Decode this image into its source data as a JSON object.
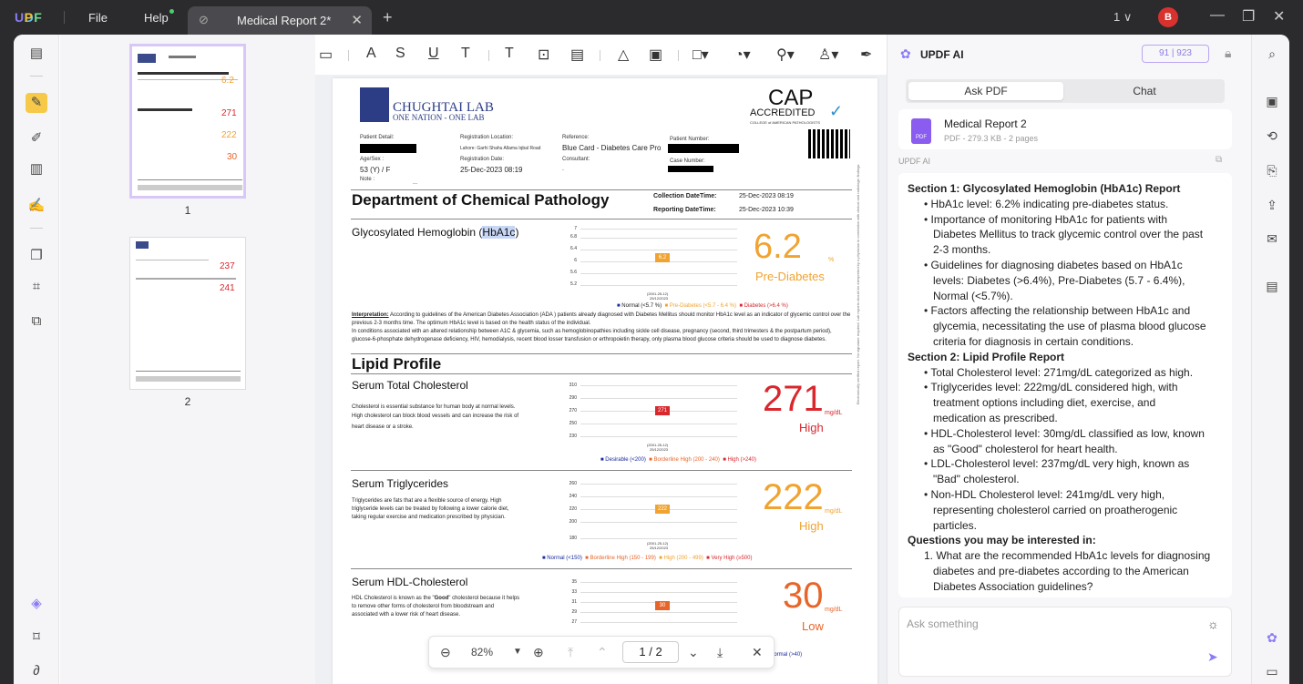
{
  "app": {
    "logo": "UPDF",
    "menu_file": "File",
    "menu_help": "Help",
    "tab_title": "Medical Report 2*",
    "tab_close": "✕",
    "new_tab": "+",
    "page_indicator": "1 ∨",
    "avatar_letter": "B",
    "minimize": "—",
    "restore": "❐",
    "close": "✕",
    "accent_color": "#8a7cf5"
  },
  "thumbnails": [
    {
      "number": "1",
      "v1": "6.2",
      "v2": "271",
      "v3": "222",
      "v4": "30"
    },
    {
      "number": "2",
      "v1": "237",
      "v2": "241"
    }
  ],
  "document": {
    "lab_name": "CHUGHTAI LAB",
    "lab_motto": "ONE NATION - ONE LAB",
    "cap": "CAP",
    "cap_accredited": "ACCREDITED",
    "cap_college": "COLLEGE of AMERICAN PATHOLOGISTS",
    "patient_detail_label": "Patient Detail:",
    "registration_location_label": "Registration Location:",
    "registration_location": "Lahore: Garhi Shahu Allama Iqbal Road",
    "reference_label": "Reference:",
    "reference": "Blue Card - Diabetes Care Pro",
    "patient_number_label": "Patient Number:",
    "age_sex_label": "Age/Sex :",
    "age_sex": "53 (Y) / F",
    "registration_date_label": "Registration Date:",
    "registration_date": "25-Dec-2023 08:19",
    "consultant_label": "Consultant:",
    "consultant": ".",
    "case_number_label": "Case Number:",
    "note_label": "Note :",
    "note_value": "...",
    "department": "Department of Chemical Pathology",
    "collection_label": "Collection DateTime:",
    "collection_value": "25-Dec-2023 08:19",
    "reporting_label": "Reporting DateTime:",
    "reporting_value": "25-Dec-2023 10:39",
    "hba1c": {
      "title_prefix": "Glycosylated Hemoglobin (",
      "title_highlight": "HbA1c",
      "title_suffix": ")",
      "value": "6.2",
      "unit": "%",
      "status": "Pre-Diabetes",
      "status_color": "#f0a330",
      "yticks": [
        "7",
        "6.8",
        "6.4",
        "6",
        "5.6",
        "5.2"
      ],
      "bar_label": "6.2",
      "date_label": "(2001-25-12)",
      "date_label2": "25/12/2023",
      "legend": [
        "Normal (<5.7 %)",
        "Pre-Diabetes (<5.7 - 6.4 %)",
        "Diabetes (>6.4 %)"
      ],
      "interpretation_label": "Interpretation:",
      "interpretation_1": "According to guidelines of the American Diabetes Association (ADA ) patients already diagnosed with Diabetes Mellitus should monitor HbA1c level as an",
      "interpretation_2": "indicator of glycemic control over the previous 2-3 months time. The optimum HbA1c level is based on the health status of the individual.",
      "interpretation_3": "In conditions associated with an altered relationship between A1C & glycemia, such as hemoglobinopathies including sickle cell disease, pregnancy (second, third trimesters",
      "interpretation_4": "& the postpartum period), glucose-6-phosphate dehydrogenase deficiency, HIV, hemodialysis, recent blood losser transfusion or erthropoietin therapy, only plasma blood",
      "interpretation_5": "glucose criteria should be used to diagnose diabetes."
    },
    "lipid_title": "Lipid Profile",
    "cholesterol": {
      "title": "Serum Total Cholesterol",
      "desc_1": "Cholesterol is essential substance for human body at normal levels.",
      "desc_2": "High cholesterol can block blood vessels and can increase the risk of",
      "desc_3": "heart disease or a stroke.",
      "value": "271",
      "unit": "mg/dL",
      "status": "High",
      "color": "#d8272d",
      "yticks": [
        "310",
        "290",
        "270",
        "250",
        "230"
      ],
      "bar_label": "271",
      "date_label": "(2001-25-12)",
      "date_label2": "25/12/2023",
      "legend": [
        "Desirable (<200)",
        "Borderline High (200 - 240)",
        "High (>240)"
      ]
    },
    "triglycerides": {
      "title": "Serum Triglycerides",
      "desc_1": "Triglycerides are fats that are a flexible source of energy. High",
      "desc_2": "triglyceride levels can be treated by following a lower calorie diet,",
      "desc_3": "taking regular exercise and medication prescribed by physician.",
      "value": "222",
      "unit": "mg/dL",
      "status": "High",
      "color": "#f0a330",
      "yticks": [
        "260",
        "240",
        "220",
        "200",
        "180"
      ],
      "bar_label": "222",
      "date_label": "(2001-25-12)",
      "date_label2": "25/12/2023",
      "legend": [
        "Normal (<150)",
        "Borderline High (150 - 199)",
        "High (200 - 499)",
        "Very High (≥500)"
      ]
    },
    "hdl": {
      "title": "Serum HDL-Cholesterol",
      "desc_1_a": "HDL Cholesterol is known as the \"",
      "desc_1_b": "Good",
      "desc_1_c": "\" cholesterol because it helps",
      "desc_2": "to remove other forms of cholesterol from bloodstream and",
      "desc_3": "associated with a lower risk of heart disease.",
      "value": "30",
      "unit": "mg/dL",
      "status": "Low",
      "color": "#e8652a",
      "yticks": [
        "35",
        "33",
        "31",
        "29",
        "27"
      ],
      "bar_label": "30",
      "legend_partial": "Normal (>40)"
    },
    "side_note": "Electronically verified report. No signature required. Lab reports should be interpreted by a physician in correlation with clinical and radiologic findings."
  },
  "nav": {
    "zoom": "82%",
    "page_current": "1",
    "page_sep": "/",
    "page_total": "2"
  },
  "ai": {
    "title": "UPDF AI",
    "credits_a": "91",
    "credits_b": "923",
    "tab_ask": "Ask PDF",
    "tab_chat": "Chat",
    "file_name": "Medical Report 2",
    "file_meta": "PDF - 279.3 KB - 2 pages",
    "file_icon_label": "PDF",
    "section_label": "UPDF AI",
    "messages": [
      {
        "text": "Section 1: Glycosylated Hemoglobin (HbA1c) Report",
        "bold": true,
        "indent": 0
      },
      {
        "text": "• HbA1c level: 6.2% indicating pre-diabetes status.",
        "indent": 1
      },
      {
        "text": "• Importance of monitoring HbA1c for patients with",
        "indent": 1
      },
      {
        "text": "Diabetes Mellitus to track glycemic control over the past",
        "indent": 2
      },
      {
        "text": "2-3 months.",
        "indent": 2
      },
      {
        "text": "• Guidelines for diagnosing diabetes based on HbA1c",
        "indent": 1
      },
      {
        "text": "levels: Diabetes (>6.4%), Pre-Diabetes (5.7 - 6.4%),",
        "indent": 2
      },
      {
        "text": "Normal (<5.7%).",
        "indent": 2
      },
      {
        "text": "• Factors affecting the relationship between HbA1c and",
        "indent": 1
      },
      {
        "text": "glycemia, necessitating the use of plasma blood glucose",
        "indent": 2
      },
      {
        "text": "criteria for diagnosis in certain conditions.",
        "indent": 2
      },
      {
        "text": "Section 2: Lipid Profile Report",
        "bold": true,
        "indent": 0
      },
      {
        "text": "• Total Cholesterol level: 271mg/dL categorized as high.",
        "indent": 1
      },
      {
        "text": "• Triglycerides level: 222mg/dL considered high, with",
        "indent": 1
      },
      {
        "text": "treatment options including diet, exercise, and",
        "indent": 2
      },
      {
        "text": "medication as prescribed.",
        "indent": 2
      },
      {
        "text": "• HDL-Cholesterol level: 30mg/dL classified as low, known",
        "indent": 1
      },
      {
        "text": "as \"Good\" cholesterol for heart health.",
        "indent": 2
      },
      {
        "text": "• LDL-Cholesterol level: 237mg/dL very high, known as",
        "indent": 1
      },
      {
        "text": "\"Bad\" cholesterol.",
        "indent": 2
      },
      {
        "text": "• Non-HDL Cholesterol level: 241mg/dL very high,",
        "indent": 1
      },
      {
        "text": "representing cholesterol carried on proatherogenic",
        "indent": 2
      },
      {
        "text": "particles.",
        "indent": 2
      },
      {
        "text": "Questions you may be interested in:",
        "bold": true,
        "indent": 0
      },
      {
        "text": "1. What are the recommended HbA1c levels for diagnosing",
        "indent": 1
      },
      {
        "text": "diabetes and pre-diabetes according to the American",
        "indent": 2
      },
      {
        "text": "Diabetes Association guidelines?",
        "indent": 2
      }
    ],
    "input_placeholder": "Ask something"
  }
}
